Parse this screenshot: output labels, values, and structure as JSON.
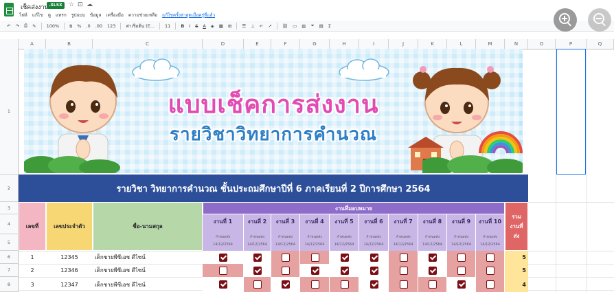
{
  "app": {
    "title": "เช็คส่งงาน",
    "file_badge": ".XLSX",
    "menu": [
      "ไฟล์",
      "แก้ไข",
      "ดู",
      "แทรก",
      "รูปแบบ",
      "ข้อมูล",
      "เครื่องมือ",
      "ความช่วยเหลือ",
      "แก้ไขครั้งล่าสุดเมื่อครู่ที่แล้ว"
    ]
  },
  "toolbar": {
    "zoom": "100%",
    "currency": "฿",
    "percent": "%",
    "decimals_down": ".0",
    "decimals_up": ".00",
    "format": "123",
    "font": "ค่าเริ่มต้น (E...",
    "font_size": "11"
  },
  "columns": [
    "A",
    "B",
    "C",
    "D",
    "E",
    "F",
    "G",
    "H",
    "I",
    "J",
    "K",
    "L",
    "M",
    "N",
    "O",
    "P",
    "Q"
  ],
  "rows": [
    "1",
    "2",
    "3",
    "4",
    "5",
    "6",
    "7",
    "8"
  ],
  "banner": {
    "title": "แบบเช็คการส่งงาน",
    "subtitle": "รายวิชาวิทยาการคำนวณ"
  },
  "subject_line": "รายวิชา วิทยาการคำนวณ ชั้นประถมศึกษาปีที่ 6 ภาคเรียนที่ 2 ปีการศึกษา 2564",
  "table": {
    "col_no": "เลขที่",
    "col_id": "เลขประจำตัว",
    "col_name": "ชื่อ-นามสกุล",
    "assigned_header": "งานที่มอบหมาย",
    "total_header_lines": [
      "รวม",
      "งานที่",
      "ส่ง"
    ],
    "tasks": [
      {
        "name": "งานที่ 1",
        "sub": "กำหนดส่ง",
        "date": "14/12/2564"
      },
      {
        "name": "งานที่ 2",
        "sub": "กำหนดส่ง",
        "date": "14/12/2564"
      },
      {
        "name": "งานที่ 3",
        "sub": "กำหนดส่ง",
        "date": "14/12/2564"
      },
      {
        "name": "งานที่ 4",
        "sub": "กำหนดส่ง",
        "date": "14/12/2564"
      },
      {
        "name": "งานที่ 5",
        "sub": "กำหนดส่ง",
        "date": "14/12/2564"
      },
      {
        "name": "งานที่ 6",
        "sub": "กำหนดส่ง",
        "date": "14/12/2564"
      },
      {
        "name": "งานที่ 7",
        "sub": "กำหนดส่ง",
        "date": "14/12/2564"
      },
      {
        "name": "งานที่ 8",
        "sub": "กำหนดส่ง",
        "date": "14/12/2564"
      },
      {
        "name": "งานที่ 9",
        "sub": "กำหนดส่ง",
        "date": "14/12/2564"
      },
      {
        "name": "งานที่ 10",
        "sub": "กำหนดส่ง",
        "date": "14/12/2564"
      }
    ],
    "students": [
      {
        "no": "1",
        "id": "12345",
        "name": "เด็กชายพีซีเอช ดีไซน์",
        "checks": [
          true,
          true,
          false,
          false,
          true,
          true,
          false,
          true,
          false,
          false
        ],
        "total": "5"
      },
      {
        "no": "2",
        "id": "12346",
        "name": "เด็กชายพีซีเอช ดีไซน์",
        "checks": [
          false,
          true,
          false,
          true,
          true,
          true,
          false,
          true,
          false,
          false
        ],
        "total": "5"
      },
      {
        "no": "3",
        "id": "12347",
        "name": "เด็กชายพีซีเอช ดีไซน์",
        "checks": [
          true,
          false,
          true,
          false,
          false,
          true,
          false,
          false,
          true,
          false
        ],
        "total": "4"
      }
    ]
  },
  "colors": {
    "banner_title": "#e24bb3",
    "banner_subtitle": "#2f7fc6",
    "subject_bar": "#2d4f9a",
    "header_pink": "#f4b6c2",
    "header_yellow": "#f7d774",
    "header_green": "#b6d7a8",
    "header_purple": "#8e6cc9",
    "total_header": "#e06666",
    "total_cell": "#ffe599",
    "checkbox": "#7a0f14",
    "unchecked_cell": "#e6a1a1"
  }
}
